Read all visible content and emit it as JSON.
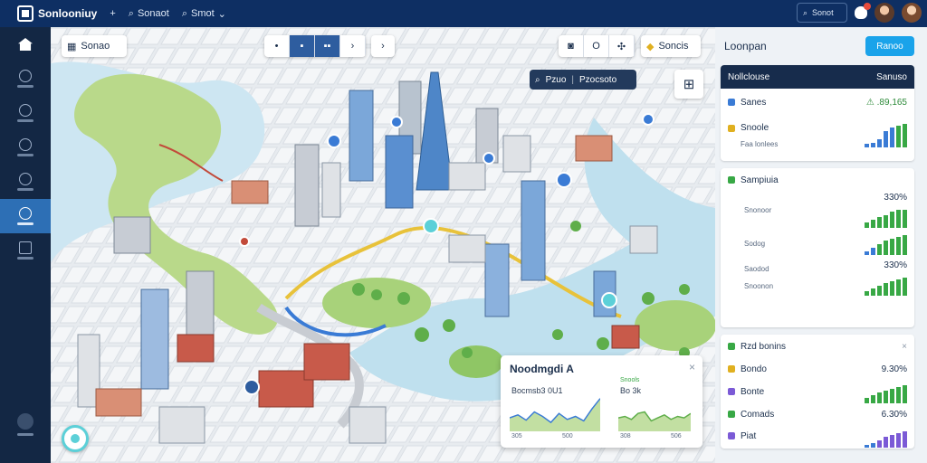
{
  "app": {
    "title": "Sonlooniuy",
    "logo_icon": "grid-logo-icon"
  },
  "topbar": {
    "add_label": "+",
    "item1_label": "Sonaot",
    "item2_label": "Smot",
    "search_label": "Sonot"
  },
  "sidebar": {
    "items": [
      {
        "icon": "home-icon",
        "active": false
      },
      {
        "icon": "compass-icon",
        "active": false
      },
      {
        "icon": "clock-icon",
        "active": false
      },
      {
        "icon": "chat-icon",
        "active": false
      },
      {
        "icon": "settings-icon",
        "active": false
      },
      {
        "icon": "globe-icon",
        "active": true
      },
      {
        "icon": "layers-icon",
        "active": false
      }
    ]
  },
  "map": {
    "search_label": "Sonao",
    "nav_labels": [
      "•",
      "▪",
      "▪▪",
      "›"
    ],
    "forward_label": "›",
    "tool_labels": [
      "◙",
      "O",
      "✣"
    ],
    "search_button_label": "Soncis",
    "chip_left": "Pzuo",
    "chip_right": "Pzocsoto",
    "layer_label": "⊞"
  },
  "popup": {
    "title": "Noodmgdi A",
    "left_label": "Bocmsb3 0U1",
    "legend": "Snools",
    "right_label": "Bo 3k",
    "left_axis": [
      "305",
      "500"
    ],
    "right_axis": [
      "308",
      "506"
    ],
    "chart_left": [
      18,
      22,
      15,
      26,
      20,
      12,
      24,
      16,
      20,
      14,
      30,
      44
    ],
    "chart_right": [
      18,
      20,
      16,
      24,
      26,
      14,
      18,
      22,
      16,
      20,
      18,
      24
    ]
  },
  "panel": {
    "title": "Loonpan",
    "button_label": "Ranoo",
    "cards": [
      {
        "header": {
          "name": "Nollclouse",
          "value": "Sanuso"
        },
        "rows": [
          {
            "name": "Sanes",
            "value": "⚠ .89,165",
            "color": "#3a7bd5",
            "bars": [
              0,
              0,
              0,
              0,
              0,
              0,
              0
            ]
          },
          {
            "name": "Snoole",
            "sub": "Faa lonlees",
            "color": "#e0b020",
            "bars": [
              4,
              5,
              9,
              18,
              22,
              24,
              26
            ]
          }
        ]
      },
      {
        "rows": [
          {
            "name": "Sampiuia",
            "value": "",
            "color": "#38a845",
            "bars": []
          },
          {
            "name": "Snonoor",
            "value": "330%",
            "color": "#38a845",
            "bars": [
              6,
              9,
              12,
              14,
              18,
              20,
              20
            ]
          },
          {
            "name": "Sodog",
            "value": "",
            "color": "#38a845",
            "bars": [
              4,
              8,
              12,
              16,
              18,
              20,
              22
            ]
          },
          {
            "name": "Saodod",
            "value": "330%",
            "color": "#38a845",
            "bars": [
              5,
              8,
              11,
              14,
              16,
              18,
              20
            ]
          },
          {
            "name": "Snoonon",
            "value": "",
            "color": "#38a845",
            "bars": []
          }
        ]
      },
      {
        "header2": "Rzd bonins",
        "rows": [
          {
            "name": "Bondo",
            "value": "9.30%",
            "color": "#e0b020",
            "bars": []
          },
          {
            "name": "Bonte",
            "value": "",
            "color": "#7b5ad6",
            "bars": [
              6,
              9,
              12,
              14,
              16,
              18,
              20
            ]
          },
          {
            "name": "Comads",
            "value": "6.30%",
            "color": "#38a845",
            "bars": []
          },
          {
            "name": "Piat",
            "value": "",
            "color": "#7b5ad6",
            "bars": [
              3,
              5,
              8,
              12,
              14,
              16,
              18
            ]
          }
        ]
      }
    ]
  }
}
